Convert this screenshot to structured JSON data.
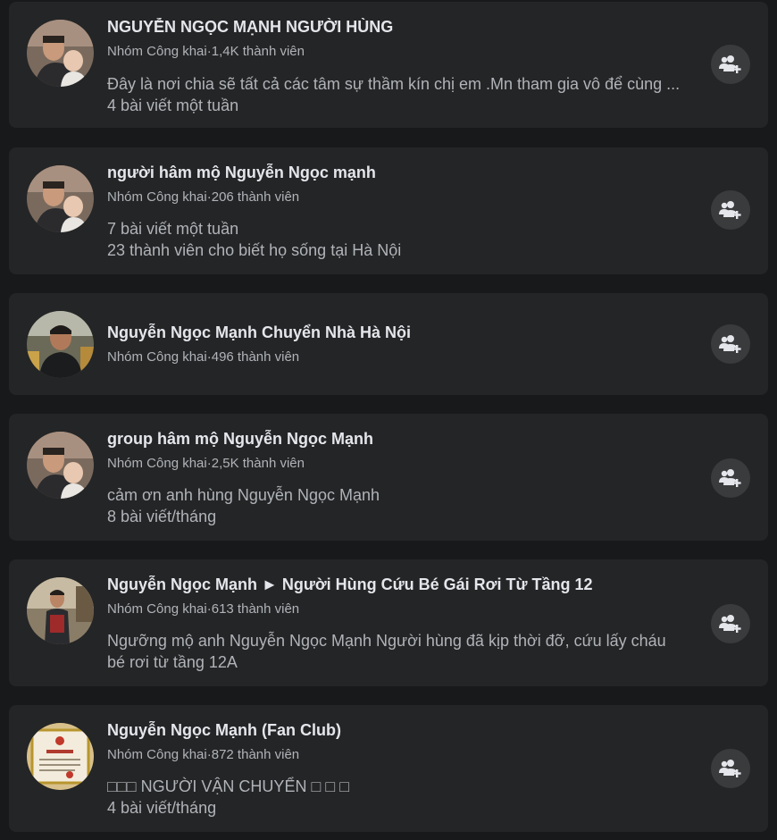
{
  "groups": [
    {
      "title": "NGUYỄN NGỌC MẠNH NGƯỜI HÙNG",
      "privacy": "Nhóm Công khai",
      "separator": "·",
      "members": "1,4K thành viên",
      "lines": [
        "Đây là nơi chia sẽ tất cả các tâm sự thầm kín chị em .Mn tham gia vô để cùng ...",
        "4 bài viết một tuần"
      ],
      "avatar": "man-holding-baby-photo",
      "join_icon": "join-group-icon"
    },
    {
      "title": "người hâm mộ Nguyễn Ngọc mạnh",
      "privacy": "Nhóm Công khai",
      "separator": "·",
      "members": "206 thành viên",
      "lines": [
        "7 bài viết một tuần",
        "23 thành viên cho biết họ sống tại Hà Nội"
      ],
      "avatar": "man-holding-baby-photo",
      "join_icon": "join-group-icon"
    },
    {
      "title": "Nguyễn Ngọc Mạnh Chuyển Nhà Hà Nội",
      "privacy": "Nhóm Công khai",
      "separator": "·",
      "members": "496 thành viên",
      "lines": [],
      "avatar": "man-smiling-photo",
      "join_icon": "join-group-icon"
    },
    {
      "title": "group hâm mộ Nguyễn Ngọc Mạnh",
      "privacy": "Nhóm Công khai",
      "separator": "·",
      "members": "2,5K thành viên",
      "lines": [
        "cảm ơn anh hùng Nguyễn Ngọc Mạnh",
        "8 bài viết/tháng"
      ],
      "avatar": "man-holding-baby-photo",
      "join_icon": "join-group-icon"
    },
    {
      "title": "Nguyễn Ngọc Mạnh ► Người Hùng Cứu Bé Gái Rơi Từ Tầng 12",
      "privacy": "Nhóm Công khai",
      "separator": "·",
      "members": "613 thành viên",
      "lines": [
        "Ngưỡng mộ anh Nguyễn Ngọc Mạnh Người hùng đã kịp thời đỡ, cứu lấy cháu",
        "bé rơi từ tầng 12A"
      ],
      "avatar": "man-standing-photo",
      "join_icon": "join-group-icon"
    },
    {
      "title": "Nguyễn Ngọc Mạnh (Fan Club)",
      "privacy": "Nhóm Công khai",
      "separator": "·",
      "members": "872 thành viên",
      "lines": [
        "□□□ NGƯỜI VẬN CHUYỂN □ □ □",
        "4 bài viết/tháng"
      ],
      "avatar": "certificate-photo",
      "join_icon": "join-group-icon"
    }
  ]
}
